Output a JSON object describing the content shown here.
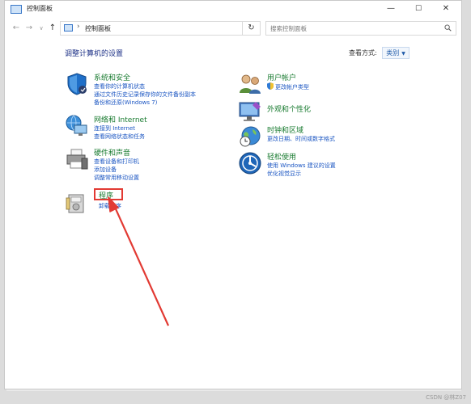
{
  "window": {
    "title": "控制面板",
    "minimize_glyph": "—",
    "maximize_glyph": "☐",
    "close_glyph": "✕"
  },
  "nav": {
    "back_glyph": "←",
    "forward_glyph": "→",
    "recent_glyph": "∨",
    "up_glyph": "↑",
    "path_separator": "›",
    "path": "控制面板",
    "refresh_glyph": "↻"
  },
  "search": {
    "placeholder": "搜索控制面板"
  },
  "main": {
    "heading": "调整计算机的设置",
    "view_by_label": "查看方式:",
    "view_by_value": "类别",
    "view_by_arrow": "▼"
  },
  "categories": [
    {
      "title": "系统和安全",
      "icon": "shield-icon",
      "links": [
        "查看你的计算机状态",
        "通过文件历史记录保存你的文件备份副本",
        "备份和还原(Windows 7)"
      ]
    },
    {
      "title": "网络和 Internet",
      "icon": "network-icon",
      "links": [
        "连接到 Internet",
        "查看网络状态和任务"
      ]
    },
    {
      "title": "硬件和声音",
      "icon": "printer-icon",
      "links": [
        "查看设备和打印机",
        "添加设备",
        "调整常用移动设置"
      ]
    },
    {
      "title": "程序",
      "icon": "programs-icon",
      "links": [
        "卸载程序"
      ]
    },
    {
      "title": "用户帐户",
      "icon": "users-icon",
      "links": [
        "更改帐户类型"
      ]
    },
    {
      "title": "外观和个性化",
      "icon": "appearance-icon",
      "links": []
    },
    {
      "title": "时钟和区域",
      "icon": "clock-icon",
      "links": [
        "更改日期、时间或数字格式"
      ]
    },
    {
      "title": "轻松使用",
      "icon": "accessibility-icon",
      "links": [
        "使用 Windows 建议的设置",
        "优化视觉显示"
      ]
    }
  ],
  "colors": {
    "category_title": "#197b30",
    "link": "#1a55c2",
    "heading": "#1e3287",
    "annotation_red": "#e23a33"
  },
  "watermark": "CSDN @林Z07"
}
